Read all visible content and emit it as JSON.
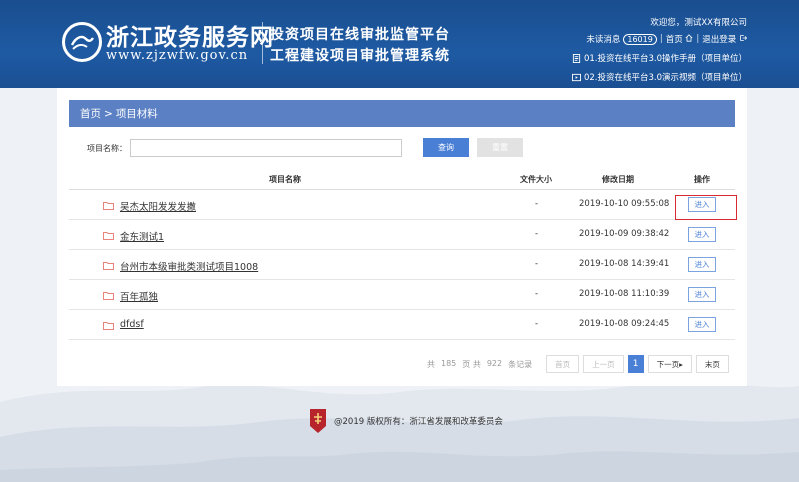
{
  "header": {
    "logo_cn": "浙江政务服务网",
    "logo_en": "www.zjzwfw.gov.cn",
    "system_title_1": "投资项目在线审批监管平台",
    "system_title_2": "工程建设项目审批管理系统",
    "welcome": "欢迎您，测试XX有限公司",
    "unread_label": "未读消息",
    "unread_count": "16019",
    "home_label": "首页",
    "logout_label": "退出登录",
    "guide_1": "01.投资在线平台3.0操作手册（项目单位）",
    "guide_2": "02.投资在线平台3.0演示视频（项目单位）",
    "colors": {
      "header_bg": "#1e5aa3",
      "accent": "#4a7fd6",
      "highlight": "#d9282f"
    }
  },
  "breadcrumb": {
    "home": "首页",
    "separator": ">",
    "current": "项目材料"
  },
  "search": {
    "label": "项目名称：",
    "value": "",
    "placeholder": "",
    "query_button": "查询",
    "reset_button": "重置"
  },
  "table": {
    "headers": {
      "name": "项目名称",
      "size": "文件大小",
      "date": "修改日期",
      "op": "操作"
    },
    "rows": [
      {
        "name": "吴杰太阳发发发撒",
        "size": "-",
        "date": "2019-10-10 09:55:08",
        "action": "进入"
      },
      {
        "name": "金东测试1",
        "size": "-",
        "date": "2019-10-09 09:38:42",
        "action": "进入"
      },
      {
        "name": "台州市本级审批类测试项目1008",
        "size": "-",
        "date": "2019-10-08 14:39:41",
        "action": "进入"
      },
      {
        "name": "百年孤独",
        "size": "-",
        "date": "2019-10-08 11:10:39",
        "action": "进入"
      },
      {
        "name": "dfdsf",
        "size": "-",
        "date": "2019-10-08 09:24:45",
        "action": "进入"
      }
    ]
  },
  "pager": {
    "total_label_1": "共",
    "pages": "185",
    "total_label_2": "页 共",
    "records": "922",
    "total_label_3": "条记录",
    "first": "首页",
    "prev": "上一页",
    "current": "1",
    "next": "下一页",
    "last": "末页"
  },
  "footer": {
    "text": "@2019 版权所有：浙江省发展和改革委员会"
  }
}
